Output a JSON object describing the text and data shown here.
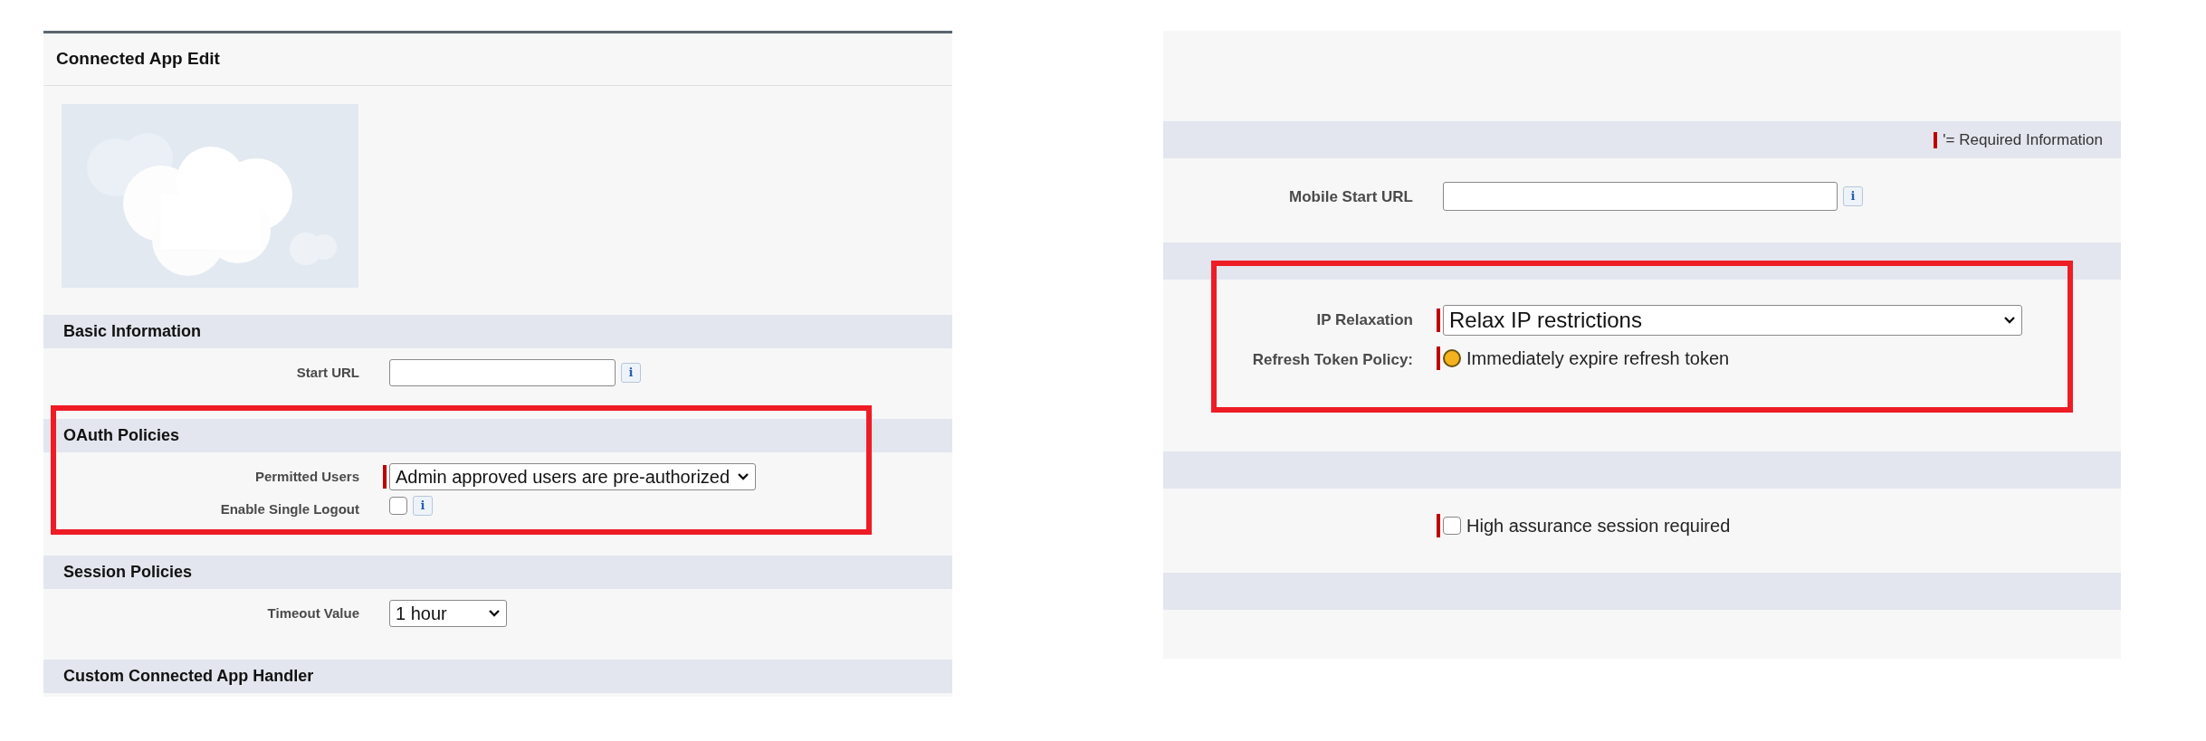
{
  "left_panel": {
    "title": "Connected App Edit",
    "sections": [
      {
        "title": "Basic Information",
        "highlighted": false,
        "fields": [
          {
            "kind": "text",
            "label": "Start URL",
            "required": false,
            "info": "i"
          }
        ]
      },
      {
        "title": "OAuth Policies",
        "highlighted": true,
        "fields": [
          {
            "kind": "select",
            "label": "Permitted Users",
            "required": true,
            "value": "Admin approved users are pre-authorized"
          },
          {
            "kind": "checkbox",
            "label": "Enable Single Logout",
            "required": false,
            "info": "i",
            "checked": false
          }
        ]
      },
      {
        "title": "Session Policies",
        "highlighted": false,
        "fields": [
          {
            "kind": "select",
            "label": "Timeout Value",
            "required": false,
            "value": "1 hour"
          }
        ]
      },
      {
        "title": "Custom Connected App Handler",
        "highlighted": false
      }
    ]
  },
  "right_panel": {
    "sections": [
      {
        "required_note": "'= Required Information",
        "highlighted": false,
        "fields": [
          {
            "kind": "text",
            "label": "Mobile Start URL",
            "required": false,
            "info": "i"
          }
        ]
      },
      {
        "highlighted": true,
        "fields": [
          {
            "kind": "select",
            "label": "IP Relaxation",
            "required": true,
            "value": "Relax IP restrictions"
          },
          {
            "kind": "radio",
            "label": "Refresh Token Policy:",
            "required": true,
            "value": "Immediately expire refresh token",
            "selected": true
          }
        ]
      },
      {
        "highlighted": false,
        "fields": [
          {
            "kind": "checkbox",
            "required": true,
            "text": "High assurance session required",
            "checked": false
          }
        ]
      },
      {
        "highlighted": false
      }
    ]
  }
}
